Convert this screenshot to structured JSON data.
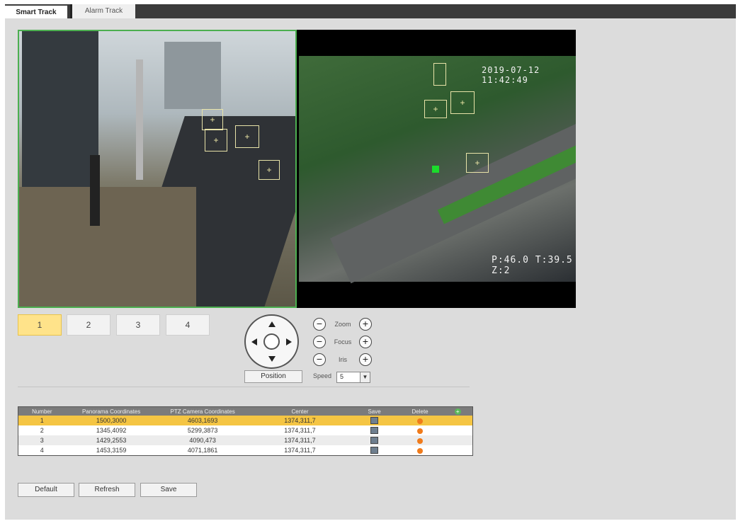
{
  "tabs": [
    {
      "label": "Smart Track",
      "active": true
    },
    {
      "label": "Alarm Track",
      "active": false
    }
  ],
  "video": {
    "timestamp": "2019-07-12 11:42:49",
    "ptz_osd": "P:46.0 T:39.5 Z:2"
  },
  "presets": [
    "1",
    "2",
    "3",
    "4"
  ],
  "selected_preset": "1",
  "controls": {
    "position_label": "Position",
    "zoom_label": "Zoom",
    "focus_label": "Focus",
    "iris_label": "Iris",
    "speed_label": "Speed",
    "speed_value": "5"
  },
  "table": {
    "headers": [
      "Number",
      "Panorama Coordinates",
      "PTZ Camera Coordinates",
      "Center",
      "Save",
      "Delete"
    ],
    "rows": [
      {
        "number": "1",
        "panorama": "1500,3000",
        "ptz": "4603,1693",
        "center": "1374,311,7",
        "selected": true
      },
      {
        "number": "2",
        "panorama": "1345,4092",
        "ptz": "5299,3873",
        "center": "1374,311,7",
        "selected": false
      },
      {
        "number": "3",
        "panorama": "1429,2553",
        "ptz": "4090,473",
        "center": "1374,311,7",
        "selected": false
      },
      {
        "number": "4",
        "panorama": "1453,3159",
        "ptz": "4071,1861",
        "center": "1374,311,7",
        "selected": false
      }
    ]
  },
  "buttons": {
    "default": "Default",
    "refresh": "Refresh",
    "save": "Save"
  },
  "colors": {
    "accent_selected": "#f5c543",
    "preset_selected": "#ffe38a",
    "tracking_border": "#4caf50",
    "delete_dot": "#f07b1b",
    "tabbar": "#3b3b3b"
  }
}
